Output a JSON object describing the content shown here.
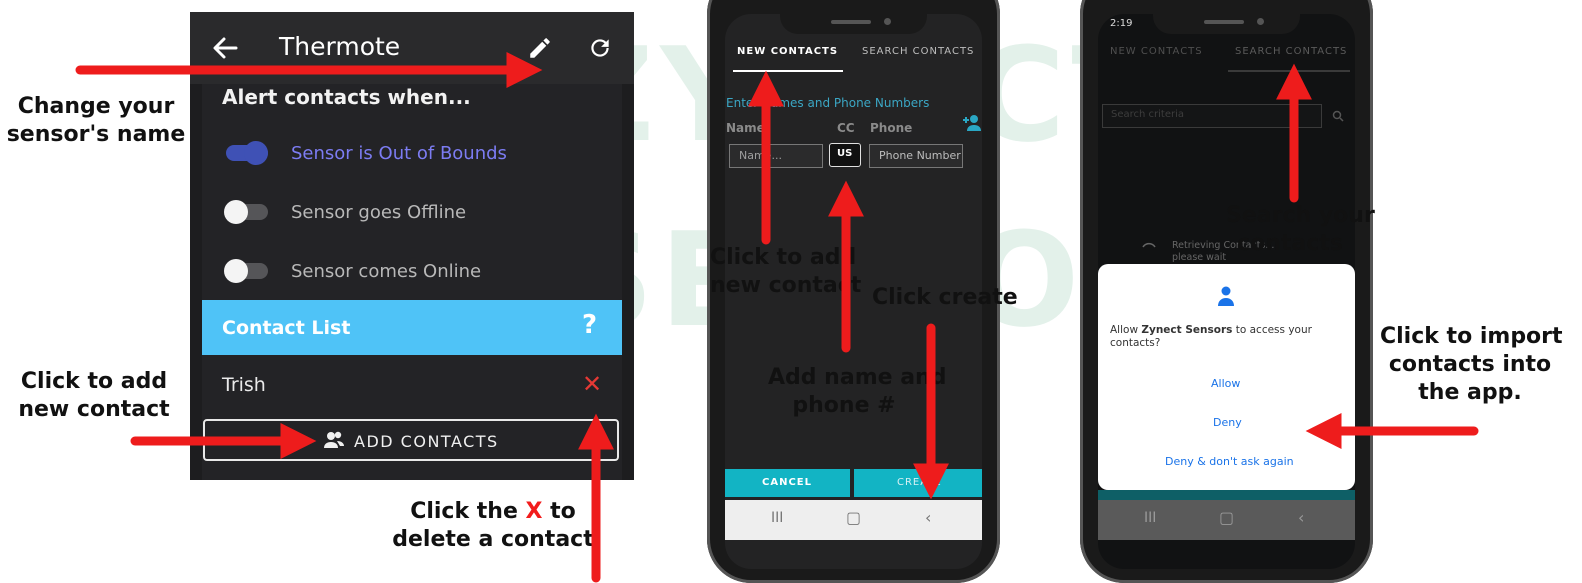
{
  "watermark": {
    "line1": "ZYNECT",
    "line2": "SENSORS",
    "reg": "®"
  },
  "panel1": {
    "title": "Thermote",
    "alert_heading": "Alert contacts when...",
    "toggles": [
      {
        "label": "Sensor is Out of Bounds",
        "on": true
      },
      {
        "label": "Sensor goes Offline",
        "on": false
      },
      {
        "label": "Sensor comes Online",
        "on": false
      }
    ],
    "contact_list_title": "Contact List",
    "help_icon": "?",
    "contacts": [
      "Trish"
    ],
    "add_contacts_label": "ADD CONTACTS",
    "colors": {
      "accent": "#4fc3f7",
      "toggle_on": "#3f51b5",
      "toggle_on_text": "#7c7cf2",
      "delete": "#e53935"
    }
  },
  "panel2": {
    "tabs": [
      "NEW CONTACTS",
      "SEARCH CONTACTS"
    ],
    "instruction": "Enter Names and Phone Numbers",
    "col_name": "Name",
    "col_cc": "CC",
    "col_phone": "Phone",
    "name_placeholder": "Name...",
    "cc_value": "US",
    "phone_placeholder": "Phone Number",
    "cancel_label": "CANCEL",
    "create_label": "CREATE"
  },
  "panel3": {
    "status_time": "2:19",
    "tabs": [
      "NEW CONTACTS",
      "SEARCH CONTACTS"
    ],
    "search_placeholder": "Search criteria",
    "retrieving": "Retrieving Contacts... please wait",
    "dialog_prefix": "Allow ",
    "dialog_app": "Zynect Sensors",
    "dialog_suffix": " to access your contacts?",
    "allow": "Allow",
    "deny": "Deny",
    "deny_never": "Deny & don't ask again"
  },
  "captions": {
    "change_name": [
      "Change your",
      "sensor's name"
    ],
    "add_new_contact_left": [
      "Click to add",
      "new contact"
    ],
    "delete_prefix": "Click the ",
    "delete_x": "X",
    "delete_suffix": " to",
    "delete_line2": "delete a contact",
    "add_new_contact_mid": [
      "Click to add",
      "new contact"
    ],
    "add_name_phone": [
      "Add name and",
      "phone #"
    ],
    "click_create": "Click create",
    "search_contacts": [
      "Search your",
      "contacts"
    ],
    "import": [
      "Click to import",
      "contacts into",
      "the app."
    ]
  }
}
